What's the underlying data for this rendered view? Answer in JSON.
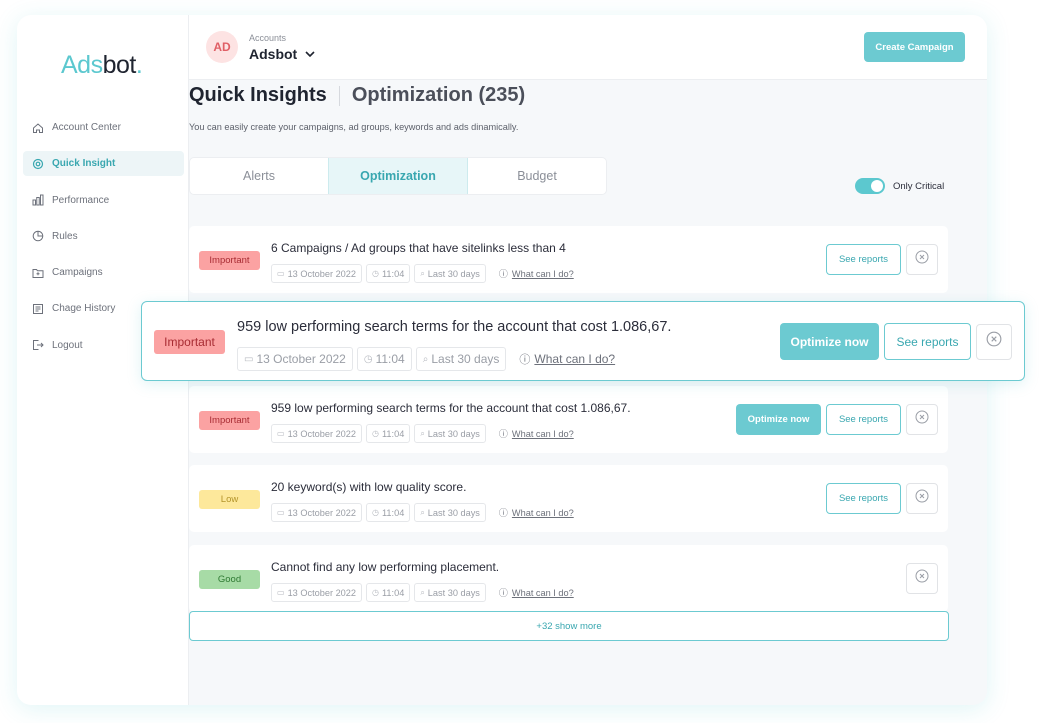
{
  "logo": {
    "part1": "Ads",
    "part2": "bot",
    "dot": "."
  },
  "sidebar": {
    "items": [
      {
        "label": "Account Center",
        "icon": "home-icon"
      },
      {
        "label": "Quick Insight",
        "icon": "insight-icon",
        "active": true
      },
      {
        "label": "Performance",
        "icon": "bar-chart-icon"
      },
      {
        "label": "Rules",
        "icon": "pie-chart-icon"
      },
      {
        "label": "Campaigns",
        "icon": "folder-icon"
      },
      {
        "label": "Chage History",
        "icon": "history-icon"
      },
      {
        "label": "Logout",
        "icon": "logout-icon"
      }
    ]
  },
  "topbar": {
    "avatar": "AD",
    "accounts_label": "Accounts",
    "account_name": "Adsbot",
    "create_button": "Create Campaign"
  },
  "page": {
    "title": "Quick Insights",
    "subtitle_title": "Optimization (235)",
    "description": "You can easily create your campaigns, ad groups, keywords and ads dinamically."
  },
  "tabs": [
    {
      "label": "Alerts"
    },
    {
      "label": "Optimization",
      "active": true
    },
    {
      "label": "Budget"
    }
  ],
  "filter": {
    "toggle_label": "Only Critical",
    "toggle_on": true
  },
  "insights": [
    {
      "badge": "Important",
      "level": "important",
      "title": "6 Campaigns / Ad groups that have sitelinks less than 4",
      "date": "13 October 2022",
      "time": "11:04",
      "range": "Last 30 days",
      "help": "What can I do?",
      "optimize": "",
      "reports": "See reports"
    },
    {
      "badge": "Important",
      "level": "important",
      "title": "959 low performing search terms for the account that cost 1.086,67.",
      "date": "13 October 2022",
      "time": "11:04",
      "range": "Last 30 days",
      "help": "What can I do?",
      "optimize": "Optimize now",
      "reports": "See reports"
    },
    {
      "badge": "Low",
      "level": "low",
      "title": "20 keyword(s) with low quality score.",
      "date": "13 October 2022",
      "time": "11:04",
      "range": "Last 30 days",
      "help": "What can I do?",
      "optimize": "",
      "reports": "See reports"
    },
    {
      "badge": "Good",
      "level": "good",
      "title": "Cannot find any low performing placement.",
      "date": "13 October 2022",
      "time": "11:04",
      "range": "Last 30 days",
      "help": "What can I do?",
      "optimize": "",
      "reports": ""
    }
  ],
  "highlight": {
    "badge": "Important",
    "title": "959 low performing search terms for the account that cost 1.086,67.",
    "date": "13 October 2022",
    "time": "11:04",
    "range": "Last 30 days",
    "help": "What can I do?",
    "optimize": "Optimize now",
    "reports": "See reports"
  },
  "show_more": "+32 show more",
  "colors": {
    "accent": "#6ccad1",
    "important": "#fba2a2",
    "low": "#fde89b",
    "good": "#a7dba6"
  }
}
